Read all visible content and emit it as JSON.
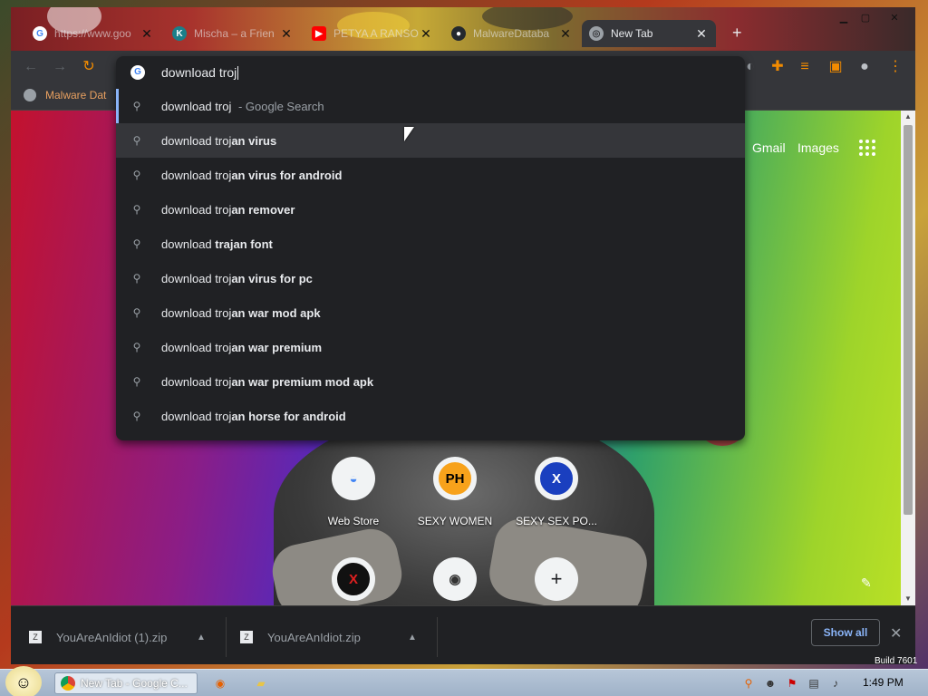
{
  "tabs": [
    {
      "title": "https://www.goo",
      "favicon": "google-icon",
      "active": false
    },
    {
      "title": "Mischa – a Frien",
      "favicon": "k-icon",
      "active": false
    },
    {
      "title": "PETYA A RANSO",
      "favicon": "youtube-icon",
      "active": false
    },
    {
      "title": "MalwareDataba",
      "favicon": "github-icon",
      "active": false
    },
    {
      "title": "New Tab",
      "favicon": "chrome-icon",
      "active": true
    }
  ],
  "bookmarks": {
    "item": "Malware Dat"
  },
  "omnibox": {
    "typed": "download troj",
    "suggestions": [
      {
        "prefix": "download troj",
        "bold": "",
        "source": " - Google Search"
      },
      {
        "prefix": "download troj",
        "bold": "an virus",
        "source": ""
      },
      {
        "prefix": "download troj",
        "bold": "an virus for android",
        "source": ""
      },
      {
        "prefix": "download troj",
        "bold": "an remover",
        "source": ""
      },
      {
        "prefix": "download ",
        "bold": "trajan font",
        "source": ""
      },
      {
        "prefix": "download troj",
        "bold": "an virus for pc",
        "source": ""
      },
      {
        "prefix": "download troj",
        "bold": "an war mod apk",
        "source": ""
      },
      {
        "prefix": "download troj",
        "bold": "an war premium",
        "source": ""
      },
      {
        "prefix": "download troj",
        "bold": "an war premium mod apk",
        "source": ""
      },
      {
        "prefix": "download troj",
        "bold": "an horse for android",
        "source": ""
      }
    ]
  },
  "ntp": {
    "gmail": "Gmail",
    "images": "Images",
    "tiles": [
      {
        "label": "Web Store",
        "icon": "webstore-icon",
        "glyph": "◒"
      },
      {
        "label": "SEXY WOMEN",
        "icon": "ph-icon",
        "glyph": "PH"
      },
      {
        "label": "SEXY SEX PO...",
        "icon": "x-icon",
        "glyph": "X"
      },
      {
        "label": "",
        "icon": "x-red-icon",
        "glyph": "X"
      },
      {
        "label": "",
        "icon": "panda-icon",
        "glyph": "◉"
      },
      {
        "label": "",
        "icon": "add-icon",
        "glyph": "+"
      }
    ]
  },
  "downloads": {
    "items": [
      {
        "name": "YouAreAnIdiot (1).zip"
      },
      {
        "name": "YouAreAnIdiot.zip"
      }
    ],
    "show_all": "Show all"
  },
  "taskbar": {
    "window_title": "New Tab - Google C...",
    "clock": "1:49 PM"
  },
  "desktop": {
    "build": "Build 7601"
  },
  "colors": {
    "accent": "#8ab4f8",
    "omnibox_bg": "#202124",
    "toolbar_bg": "#35363a"
  }
}
